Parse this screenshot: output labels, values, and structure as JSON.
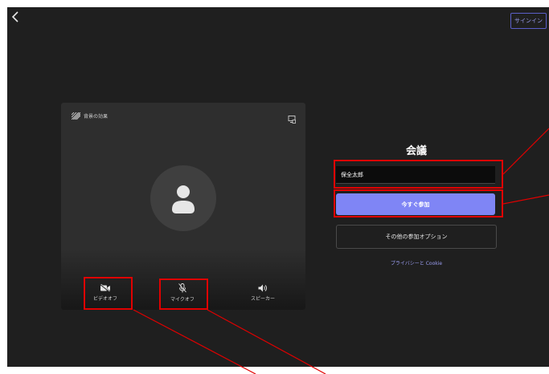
{
  "header": {
    "back_icon": "chevron-left-icon",
    "sign_in_label": "サインイン"
  },
  "preview": {
    "background_effects_label": "背景の効果",
    "background_effects_icon": "background-effects-icon",
    "device_settings_icon": "device-settings-icon",
    "avatar_icon": "person-icon",
    "controls": {
      "video": {
        "label": "ビデオオフ",
        "icon": "video-off-icon"
      },
      "mic": {
        "label": "マイクオフ",
        "icon": "mic-off-icon"
      },
      "speaker": {
        "label": "スピーカー",
        "icon": "speaker-icon"
      }
    }
  },
  "join_panel": {
    "title": "会議",
    "name_value": "保全太郎",
    "join_now_label": "今すぐ参加",
    "other_options_label": "その他の参加オプション",
    "privacy_link": "プライバシーと Cookie"
  },
  "colors": {
    "background": "#1f1f1f",
    "preview_surface": "#2e2e2e",
    "accent": "#7f85f5",
    "link": "#9a9cf0",
    "annotation": "#e00000"
  }
}
